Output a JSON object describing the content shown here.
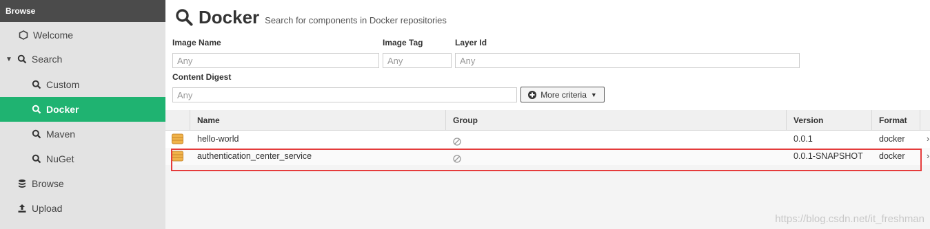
{
  "sidebar": {
    "header": "Browse",
    "items": [
      {
        "label": "Welcome",
        "icon": "hexagon-icon"
      },
      {
        "label": "Search",
        "icon": "search-icon"
      },
      {
        "label": "Custom",
        "icon": "search-icon"
      },
      {
        "label": "Docker",
        "icon": "search-icon",
        "active": true
      },
      {
        "label": "Maven",
        "icon": "search-icon"
      },
      {
        "label": "NuGet",
        "icon": "search-icon"
      },
      {
        "label": "Browse",
        "icon": "database-icon"
      },
      {
        "label": "Upload",
        "icon": "upload-icon"
      }
    ]
  },
  "header": {
    "title": "Docker",
    "subtitle": "Search for components in Docker repositories"
  },
  "criteria": {
    "image_name_label": "Image Name",
    "image_tag_label": "Image Tag",
    "layer_id_label": "Layer Id",
    "content_digest_label": "Content Digest",
    "placeholder": "Any",
    "more_criteria": "More criteria"
  },
  "grid": {
    "columns": [
      "Name",
      "Group",
      "Version",
      "Format"
    ],
    "rows": [
      {
        "name": "hello-world",
        "version": "0.0.1",
        "format": "docker"
      },
      {
        "name": "authentication_center_service",
        "version": "0.0.1-SNAPSHOT",
        "format": "docker"
      }
    ]
  },
  "watermark": "https://blog.csdn.net/it_freshman",
  "colors": {
    "accent": "#1fb371",
    "highlight": "#e53b3b",
    "sidebar_header": "#4b4b4b"
  }
}
